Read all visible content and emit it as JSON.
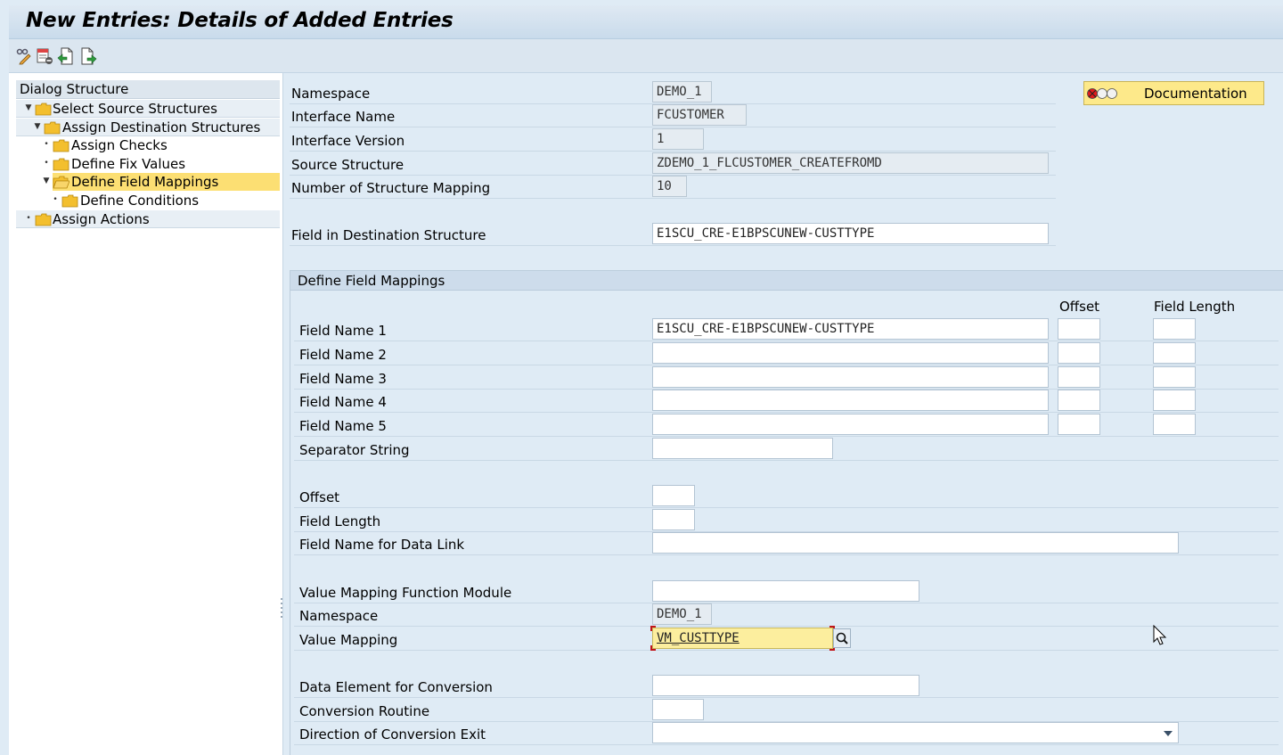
{
  "title": "New Entries: Details of Added Entries",
  "toolbar": {
    "icons": [
      "display-change-icon",
      "delete-row-icon",
      "undo-change-icon",
      "next-entry-icon"
    ]
  },
  "tree": {
    "header": "Dialog Structure",
    "items": [
      {
        "label": "Select Source Structures",
        "level": 0,
        "state": "expanded"
      },
      {
        "label": "Assign Destination Structures",
        "level": 1,
        "state": "expanded"
      },
      {
        "label": "Assign Checks",
        "level": 2,
        "state": "leaf"
      },
      {
        "label": "Define Fix Values",
        "level": 2,
        "state": "leaf"
      },
      {
        "label": "Define Field Mappings",
        "level": 2,
        "state": "expanded",
        "selected": true
      },
      {
        "label": "Define Conditions",
        "level": 3,
        "state": "leaf"
      },
      {
        "label": "Assign Actions",
        "level": 0,
        "state": "leaf"
      }
    ]
  },
  "header_fields": {
    "namespace": {
      "label": "Namespace",
      "value": "DEMO_1"
    },
    "interface_name": {
      "label": "Interface Name",
      "value": "FCUSTOMER"
    },
    "interface_version": {
      "label": "Interface Version",
      "value": "1"
    },
    "source_structure": {
      "label": "Source Structure",
      "value": "ZDEMO_1_FLCUSTOMER_CREATEFROMD"
    },
    "number_of_mapping": {
      "label": "Number of Structure Mapping",
      "value": "10"
    },
    "field_in_dest": {
      "label": "Field in Destination Structure",
      "value": "E1SCU_CRE-E1BPSCUNEW-CUSTTYPE"
    }
  },
  "documentation_button": "Documentation",
  "group": {
    "title": "Define Field Mappings",
    "col_offset": "Offset",
    "col_field_length": "Field Length",
    "field_names": [
      {
        "label": "Field Name 1",
        "value": "E1SCU_CRE-E1BPSCUNEW-CUSTTYPE"
      },
      {
        "label": "Field Name 2",
        "value": ""
      },
      {
        "label": "Field Name 3",
        "value": ""
      },
      {
        "label": "Field Name 4",
        "value": ""
      },
      {
        "label": "Field Name 5",
        "value": ""
      }
    ],
    "separator": {
      "label": "Separator String",
      "value": ""
    },
    "offset": {
      "label": "Offset",
      "value": ""
    },
    "field_length": {
      "label": "Field Length",
      "value": ""
    },
    "data_link": {
      "label": "Field Name for Data Link",
      "value": ""
    },
    "vm_function_module": {
      "label": "Value Mapping Function Module",
      "value": ""
    },
    "namespace": {
      "label": "Namespace",
      "value": "DEMO_1"
    },
    "value_mapping": {
      "label": "Value Mapping",
      "value": "VM_CUSTTYPE"
    },
    "data_element": {
      "label": "Data Element for Conversion",
      "value": ""
    },
    "conversion_routine": {
      "label": "Conversion Routine",
      "value": ""
    },
    "direction_exit": {
      "label": "Direction of Conversion Exit",
      "value": ""
    }
  }
}
